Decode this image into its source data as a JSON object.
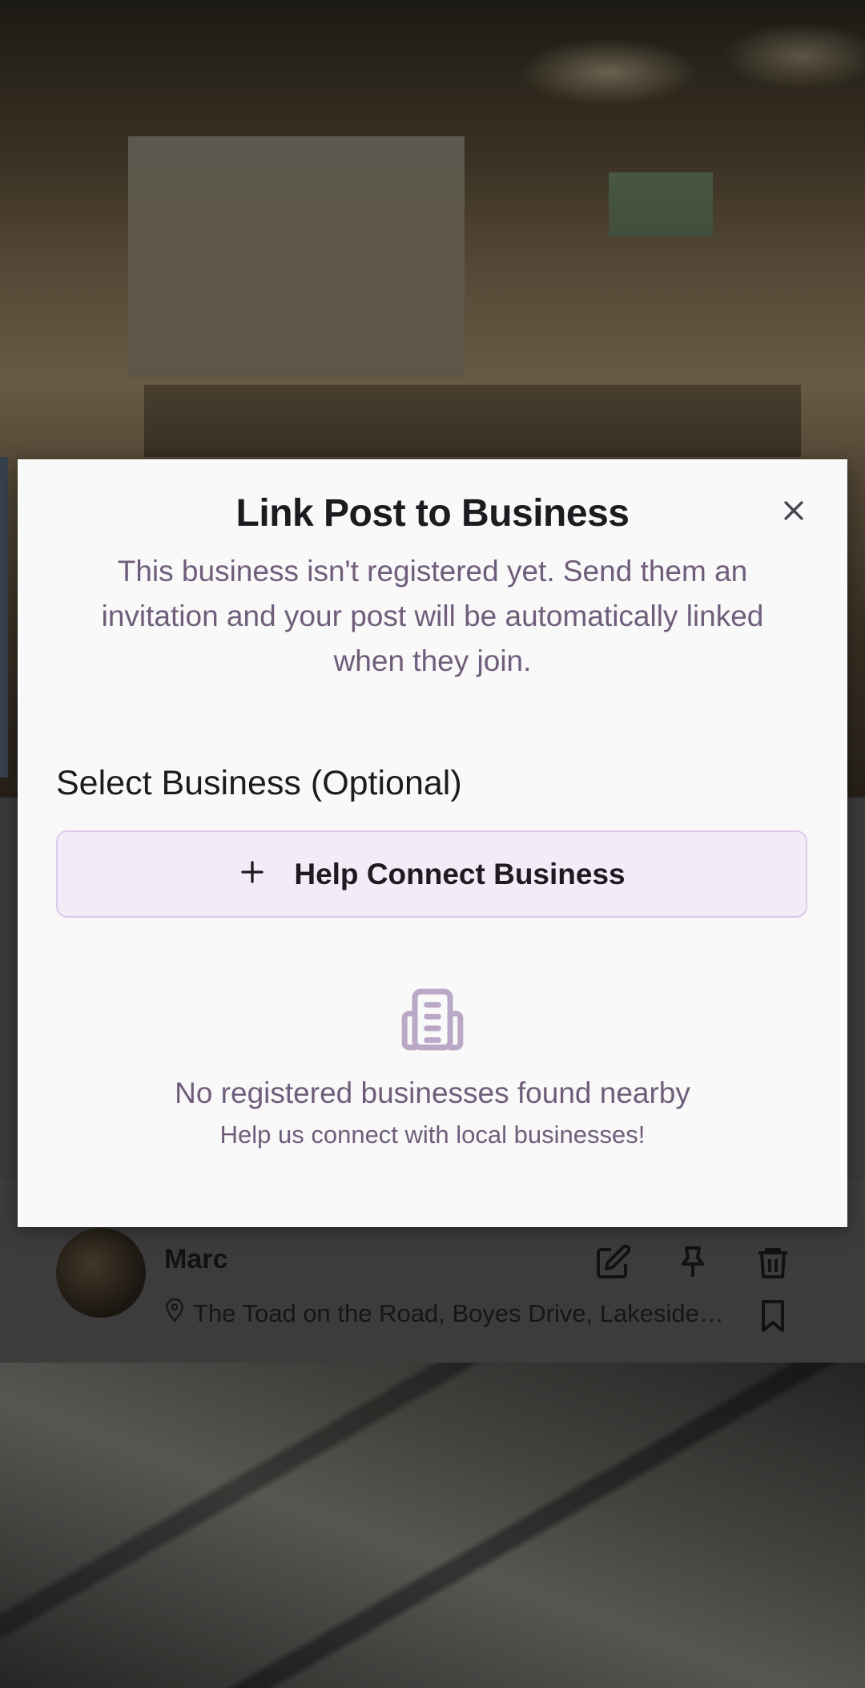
{
  "modal": {
    "title": "Link Post to Business",
    "close_icon": "close-icon",
    "description": "This business isn't registered yet. Send them an invitation and your post will be automatically linked when they join.",
    "section_label": "Select Business (Optional)",
    "connect_button": {
      "icon": "plus-icon",
      "label": "Help Connect Business"
    },
    "empty_state": {
      "icon": "building-icon",
      "title": "No registered businesses found nearby",
      "subtitle": "Help us connect with local businesses!"
    }
  },
  "post": {
    "author": "Marc",
    "location": "The Toad on the Road, Boyes Drive, Lakeside, Cape Town",
    "location_icon": "map-pin-icon",
    "actions": [
      "edit-icon",
      "pin-icon",
      "trash-icon",
      "bookmark-icon"
    ]
  },
  "colors": {
    "dialog_bg": "#f9f9f9",
    "accent_text": "#6f5e7b",
    "button_bg": "#f3ecf8",
    "button_border": "#ddc9ea",
    "title_text": "#1d1b20",
    "scrim": "#000000"
  }
}
